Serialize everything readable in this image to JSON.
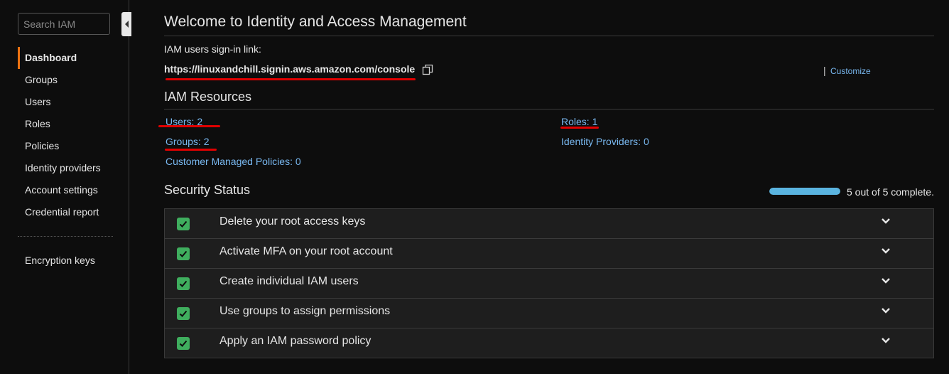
{
  "sidebar": {
    "search_placeholder": "Search IAM",
    "items": [
      {
        "label": "Dashboard",
        "active": true
      },
      {
        "label": "Groups"
      },
      {
        "label": "Users"
      },
      {
        "label": "Roles"
      },
      {
        "label": "Policies"
      },
      {
        "label": "Identity providers"
      },
      {
        "label": "Account settings"
      },
      {
        "label": "Credential report"
      }
    ],
    "secondary_items": [
      {
        "label": "Encryption keys"
      }
    ]
  },
  "main": {
    "title": "Welcome to Identity and Access Management",
    "signin_label": "IAM users sign-in link:",
    "signin_url": "https://linuxandchill.signin.aws.amazon.com/console",
    "customize_label": "Customize",
    "resources": {
      "title": "IAM Resources",
      "users": "Users: 2",
      "groups": "Groups: 2",
      "customer_policies": "Customer Managed Policies: 0",
      "roles": "Roles: 1",
      "identity_providers": "Identity Providers: 0"
    },
    "security": {
      "title": "Security Status",
      "progress_text": "5 out of 5 complete.",
      "progress_fraction": 1.0,
      "items": [
        {
          "label": "Delete your root access keys",
          "complete": true
        },
        {
          "label": "Activate MFA on your root account",
          "complete": true
        },
        {
          "label": "Create individual IAM users",
          "complete": true
        },
        {
          "label": "Use groups to assign permissions",
          "complete": true
        },
        {
          "label": "Apply an IAM password policy",
          "complete": true
        }
      ]
    }
  },
  "colors": {
    "background": "#0d0d0d",
    "link": "#79b8f0",
    "active_accent": "#ec7211",
    "check": "#3fae5e",
    "progress": "#5ab4e0",
    "annotation_underline": "#e00000"
  },
  "icons": {
    "copy": "copy-icon",
    "check": "checkmark-icon",
    "expand": "chevron-down-icon",
    "collapse": "caret-left-icon"
  }
}
